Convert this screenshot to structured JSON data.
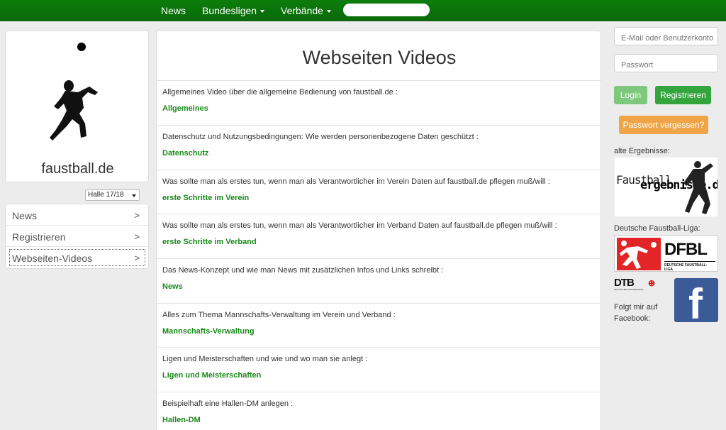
{
  "topnav": {
    "items": [
      {
        "label": "News",
        "dropdown": false
      },
      {
        "label": "Bundesligen",
        "dropdown": true
      },
      {
        "label": "Verbände",
        "dropdown": true
      }
    ],
    "search_placeholder": ""
  },
  "brand": {
    "name": "faustball.de"
  },
  "season": {
    "selected": "Halle 17/18"
  },
  "sidebar": {
    "items": [
      {
        "label": "News",
        "arrow": ">"
      },
      {
        "label": "Registrieren",
        "arrow": ">"
      },
      {
        "label": "Webseiten-Videos",
        "arrow": ">",
        "active": true
      }
    ]
  },
  "main": {
    "title": "Webseiten Videos",
    "entries": [
      {
        "desc": "Allgemeines Video über die allgemeine Bedienung von faustball.de :",
        "link": "Allgemeines"
      },
      {
        "desc": "Datenschutz und Nutzungsbedingungen: Wie werden personenbezogene Daten geschützt :",
        "link": "Datenschutz"
      },
      {
        "desc": "Was sollte man als erstes tun, wenn man als Verantwortlicher im Verein Daten auf faustball.de pflegen muß/will :",
        "link": "erste Schritte im Verein"
      },
      {
        "desc": "Was sollte man als erstes tun, wenn man als Verantwortlicher im Verband Daten auf faustball.de pflegen muß/will :",
        "link": "erste Schritte im Verband"
      },
      {
        "desc": "Das News-Konzept und wie man News mit zusätzlichen Infos und Links schreibt :",
        "link": "News"
      },
      {
        "desc": "Alles zum Thema Mannschafts-Verwaltung im Verein und Verband :",
        "link": "Mannschafts-Verwaltung"
      },
      {
        "desc": "Ligen und Meisterschaften und wie und wo man sie anlegt :",
        "link": "Ligen und Meisterschaften"
      },
      {
        "desc": "Beispielhaft eine Hallen-DM anlegen :",
        "link": "Hallen-DM"
      }
    ]
  },
  "login": {
    "email_placeholder": "E-Mail oder Benutzerkonto",
    "password_placeholder": "Passwort",
    "login_label": "Login",
    "register_label": "Registrieren",
    "forgot_label": "Passwort vergessen?"
  },
  "right": {
    "old_results_label": "alte Ergebnisse:",
    "ergebnisse_logo": {
      "prefix": "Faustball",
      "main": "ergebnisse.de"
    },
    "league_label": "Deutsche Faustball-Liga:",
    "dfbl_logo": {
      "main": "DFBL",
      "sub": "DEUTSCHE FAUSTBALL-LIGA"
    },
    "dtb_logo": {
      "main": "DTB",
      "sub": "DEUTSCHER TURNER-BUND"
    },
    "facebook_label": "Folgt mir auf Facebook:"
  },
  "colors": {
    "nav_green": "#0b7d0b",
    "link_green": "#1a8a1a",
    "login_green_light": "#7dc87d",
    "register_green": "#34a43c",
    "forgot_orange": "#efa547",
    "facebook_blue": "#3a5b98",
    "dfbl_red": "#e22526"
  }
}
